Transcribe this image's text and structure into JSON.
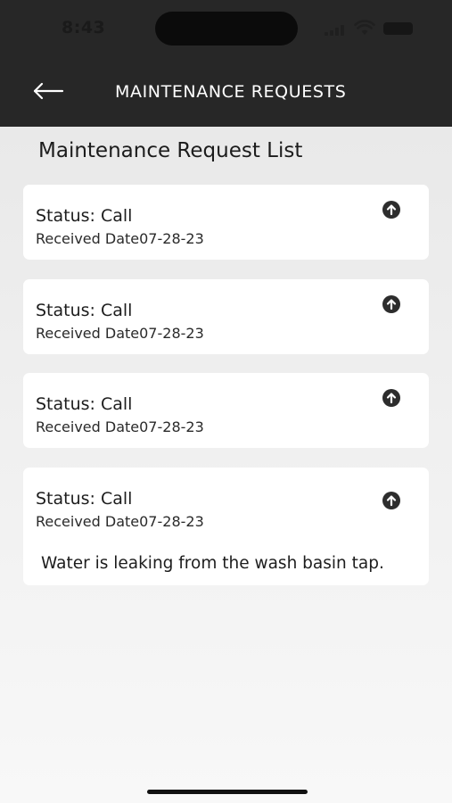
{
  "status_bar": {
    "time": "8:43",
    "icons": [
      "signal-icon",
      "wifi-icon",
      "battery-icon"
    ]
  },
  "header": {
    "title": "MAINTENANCE REQUESTS",
    "back_icon": "arrow-left-icon"
  },
  "main": {
    "list_title": "Maintenance Request List",
    "requests": [
      {
        "status": "Status: Call",
        "received": "Received Date07-28-23",
        "icon": "arrow-up-circle-icon"
      },
      {
        "status": "Status: Call",
        "received": "Received Date07-28-23",
        "icon": "arrow-up-circle-icon"
      },
      {
        "status": "Status: Call",
        "received": "Received Date07-28-23",
        "icon": "arrow-up-circle-icon"
      },
      {
        "status": "Status: Call",
        "received": "Received Date07-28-23",
        "icon": "arrow-up-circle-icon",
        "description": "Water is leaking from the wash basin tap."
      }
    ]
  },
  "colors": {
    "header_bg": "#272727",
    "card_bg": "#ffffff",
    "page_bg": "#ececec"
  }
}
